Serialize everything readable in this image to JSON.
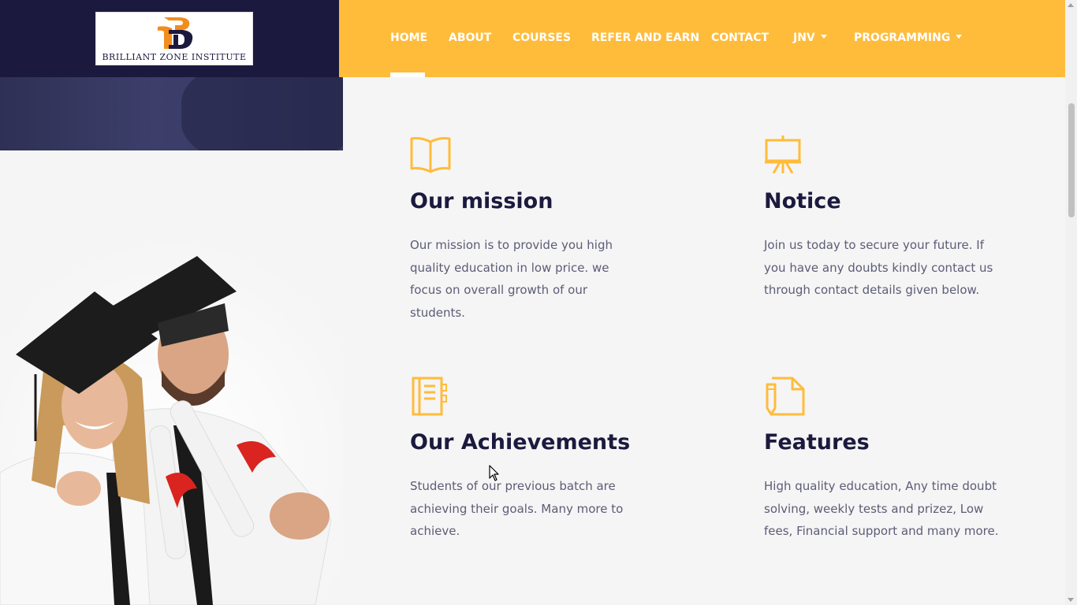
{
  "brand": {
    "name": "BRILLIANT ZONE INSTITUTE",
    "letters": "B",
    "colors": {
      "navy": "#1b1a3e",
      "accent": "#ffbc3b",
      "orange": "#f28c1c"
    }
  },
  "nav": {
    "items": [
      {
        "label": "HOME",
        "active": true
      },
      {
        "label": "ABOUT"
      },
      {
        "label": "COURSES"
      },
      {
        "label": "REFER AND EARN"
      },
      {
        "label": "CONTACT"
      },
      {
        "label": "JNV",
        "dropdown": true
      },
      {
        "label": "PROGRAMMING",
        "dropdown": true
      }
    ]
  },
  "features": [
    {
      "icon": "book-icon",
      "title": "Our mission",
      "text": "Our mission is to provide you high quality education in low price. we focus on overall growth of our students."
    },
    {
      "icon": "presentation-board-icon",
      "title": "Notice",
      "text": "Join us today to secure your future. If you have any doubts kindly contact us through contact details given below."
    },
    {
      "icon": "notebook-icon",
      "title": "Our Achievements",
      "text": "Students of our previous batch are achieving their goals. Many more to achieve."
    },
    {
      "icon": "document-pen-icon",
      "title": "Features",
      "text": "High quality education, Any time doubt solving, weekly tests and prizez, Low fees, Financial support and many more."
    }
  ]
}
